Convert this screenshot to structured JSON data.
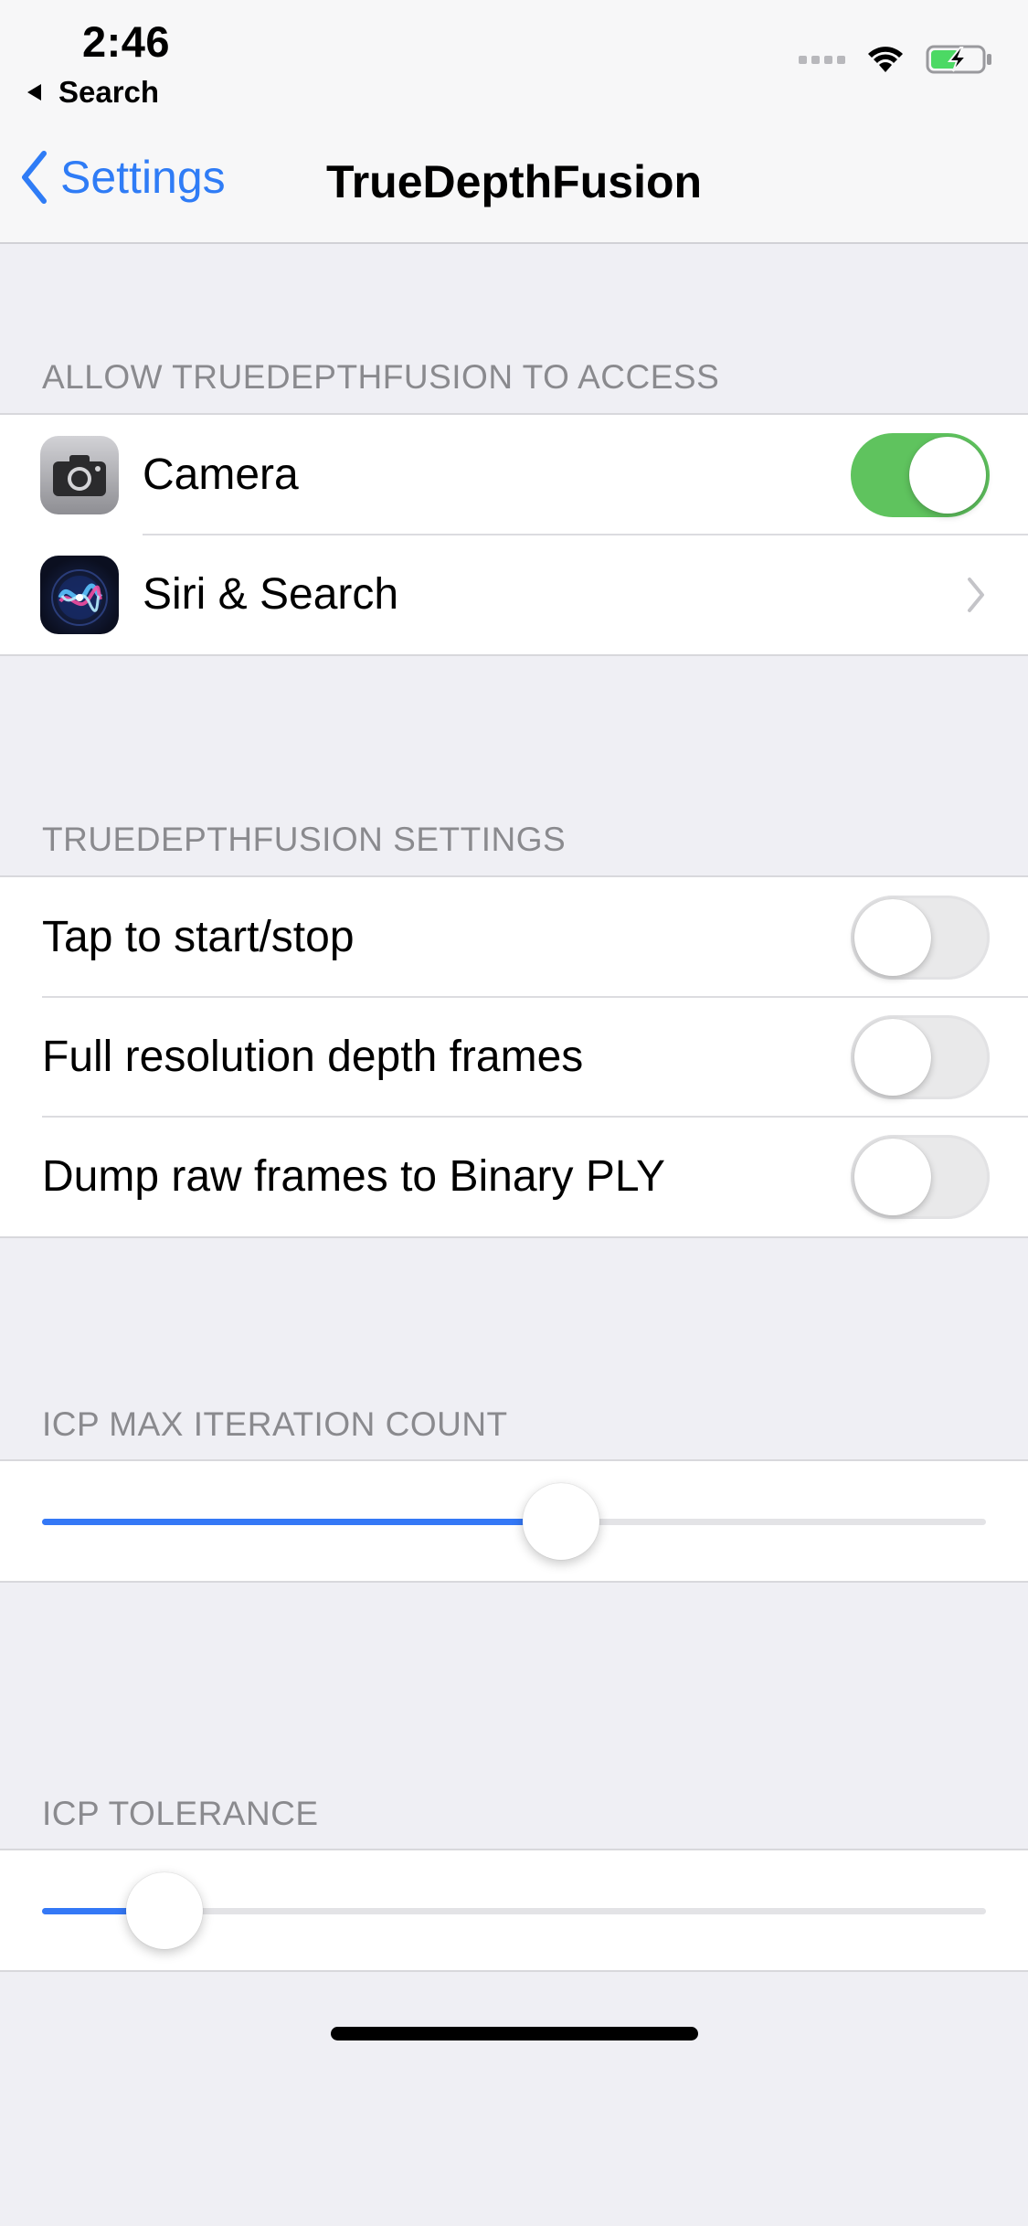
{
  "status_bar": {
    "time": "2:46",
    "back_app": "Search",
    "wifi_icon": "wifi-icon",
    "battery_icon": "battery-charging-icon",
    "battery_color": "#4cd964"
  },
  "nav": {
    "back_label": "Settings",
    "title": "TrueDepthFusion",
    "accent_color": "#2f7cf6"
  },
  "access_section": {
    "header": "ALLOW TRUEDEPTHFUSION TO ACCESS",
    "items": [
      {
        "label": "Camera",
        "icon": "camera-app-icon",
        "control": "toggle",
        "on": true
      },
      {
        "label": "Siri & Search",
        "icon": "siri-app-icon",
        "control": "chevron"
      }
    ]
  },
  "settings_section": {
    "header": "TRUEDEPTHFUSION SETTINGS",
    "items": [
      {
        "label": "Tap to start/stop",
        "on": false
      },
      {
        "label": "Full resolution depth frames",
        "on": false
      },
      {
        "label": "Dump raw frames to Binary PLY",
        "on": false
      }
    ]
  },
  "icp_max_iteration": {
    "header": "ICP MAX ITERATION COUNT",
    "slider_fraction": 0.55
  },
  "icp_tolerance": {
    "header": "ICP TOLERANCE",
    "slider_fraction": 0.13
  },
  "colors": {
    "toggle_on": "#5fc35e",
    "slider_fill": "#3478f6",
    "background": "#efeff4"
  }
}
